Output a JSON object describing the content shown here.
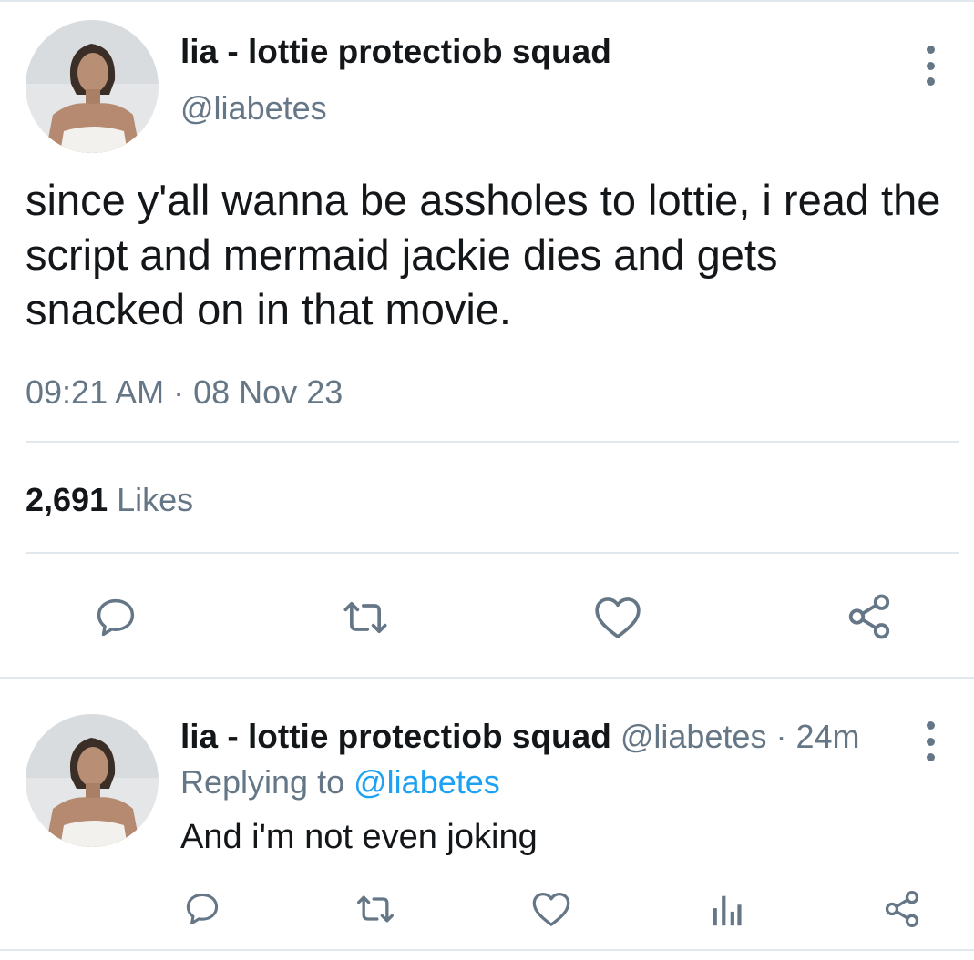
{
  "tweet": {
    "author_name": "lia - lottie protectiob squad",
    "author_handle": "@liabetes",
    "text": "since y'all wanna be assholes to lottie, i read the script and mermaid jackie dies and gets snacked on in that movie.",
    "time": "09:21 AM",
    "separator": "·",
    "date": "08 Nov 23",
    "likes_count": "2,691",
    "likes_label": "Likes",
    "icons": [
      "more-vertical-icon",
      "reply-icon",
      "retweet-icon",
      "like-icon",
      "share-icon"
    ]
  },
  "reply": {
    "author_name": "lia - lottie protectiob squad",
    "author_handle": "@liabetes",
    "separator": "·",
    "age": "24m",
    "replying_prefix": "Replying to",
    "replying_to": "@liabetes",
    "text": "And i'm not even joking",
    "icons": [
      "more-vertical-icon",
      "reply-icon",
      "retweet-icon",
      "like-icon",
      "analytics-icon",
      "share-icon"
    ]
  },
  "colors": {
    "text_primary": "#14171a",
    "text_secondary": "#657786",
    "link": "#1da1f2",
    "divider": "#e1e8ed"
  }
}
